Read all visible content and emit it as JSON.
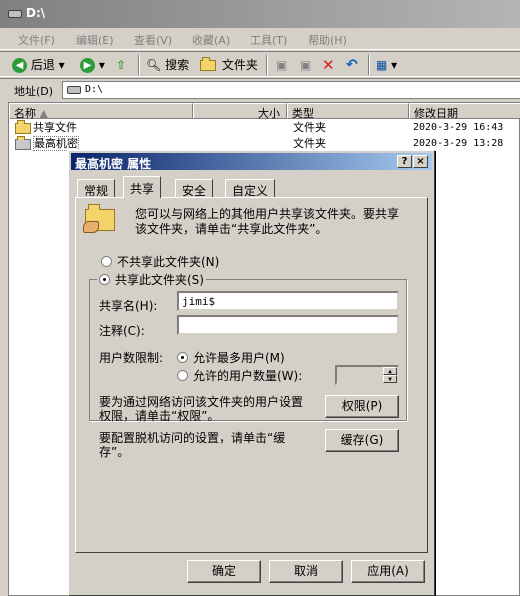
{
  "window": {
    "title": "D:\\",
    "menu": [
      "文件(F)",
      "编辑(E)",
      "查看(V)",
      "收藏(A)",
      "工具(T)",
      "帮助(H)"
    ],
    "toolbar": {
      "back": "后退",
      "search": "搜索",
      "folders": "文件夹"
    },
    "address_label": "地址(D)",
    "address_value": "D:\\"
  },
  "filelist": {
    "columns": [
      "名称",
      "大小",
      "类型",
      "修改日期"
    ],
    "rows": [
      {
        "name": "共享文件",
        "type": "文件夹",
        "date": "2020-3-29 16:43"
      },
      {
        "name": "最高机密",
        "type": "文件夹",
        "date": "2020-3-29 13:28"
      }
    ]
  },
  "dialog": {
    "title": "最高机密 属性",
    "help": "?",
    "close": "×",
    "tabs": [
      "常规",
      "共享",
      "安全",
      "自定义"
    ],
    "intro": "您可以与网络上的其他用户共享该文件夹。要共享该文件夹，请单击“共享此文件夹”。",
    "no_share": "不共享此文件夹(N)",
    "share": "共享此文件夹(S)",
    "share_name_label": "共享名(H):",
    "share_name_value": "jimi$",
    "comment_label": "注释(C):",
    "comment_value": "",
    "limit_label": "用户数限制:",
    "max_users": "允许最多用户(M)",
    "allowed_users": "允许的用户数量(W):",
    "perm_text": "要为通过网络访问该文件夹的用户设置权限，请单击“权限”。",
    "perm_button": "权限(P)",
    "cache_text": "要配置脱机访问的设置，请单击“缓存”。",
    "cache_button": "缓存(G)",
    "ok": "确定",
    "cancel": "取消",
    "apply": "应用(A)"
  },
  "colors": {
    "title_active": "#0a246a",
    "title_inactive": "#808080",
    "face": "#d4d0c8",
    "folder": "#f2d46a"
  }
}
